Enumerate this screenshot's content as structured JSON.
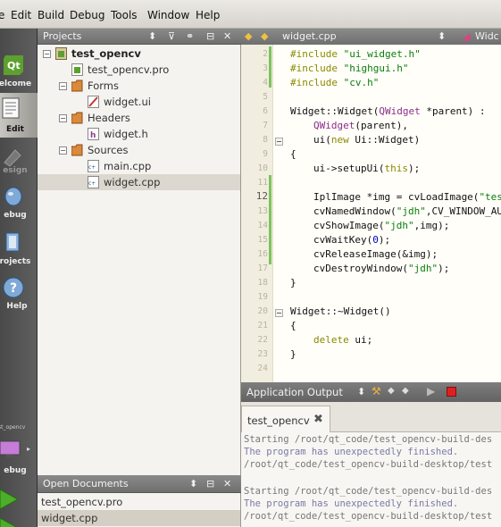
{
  "menu": [
    "e",
    "Edit",
    "Build",
    "Debug",
    "Tools",
    "Window",
    "Help"
  ],
  "modes": {
    "welcome": "elcome",
    "edit": "Edit",
    "design": "esign",
    "debug": "ebug",
    "projects": "rojects",
    "help": "Help",
    "target_small": "test_opencv",
    "target_debug": "ebug"
  },
  "projects_panel": {
    "title": "Projects",
    "project_name": "test_opencv",
    "pro_file": "test_opencv.pro",
    "forms_label": "Forms",
    "form_file": "widget.ui",
    "headers_label": "Headers",
    "header_file": "widget.h",
    "sources_label": "Sources",
    "source_file_1": "main.cpp",
    "source_file_2": "widget.cpp"
  },
  "open_documents": {
    "title": "Open Documents",
    "docs": [
      "test_opencv.pro",
      "widget.cpp"
    ]
  },
  "editor": {
    "file_tab": "widget.cpp",
    "symbol_tab": "Widc",
    "line_numbers": [
      "2",
      "3",
      "4",
      "5",
      "6",
      "7",
      "8",
      "9",
      "10",
      "11",
      "12",
      "13",
      "14",
      "15",
      "16",
      "17",
      "18",
      "19",
      "20",
      "21",
      "22",
      "23",
      "24"
    ],
    "current_line": "12"
  },
  "code_text": {
    "l2_kw": "#include ",
    "l2_str": "\"ui_widget.h\"",
    "l3_kw": "#include ",
    "l3_str": "\"highgui.h\"",
    "l4_kw": "#include ",
    "l4_str": "\"cv.h\"",
    "l6_a": "Widget::Widget(",
    "l6_ty": "QWidget",
    "l6_b": " *parent) :",
    "l7_ty": "QWidget",
    "l7_b": "(parent),",
    "l8_a": "ui(",
    "l8_kw": "new",
    "l8_b": " Ui::Widget)",
    "l9": "{",
    "l10_a": "ui->setupUi(",
    "l10_kw": "this",
    "l10_b": ");",
    "l12_a": "IplImage *img = cvLoadImage(",
    "l12_str": "\"tes",
    "l13_a": "cvNamedWindow(",
    "l13_str": "\"jdh\"",
    "l13_b": ",CV_WINDOW_AU",
    "l14_a": "cvShowImage(",
    "l14_str": "\"jdh\"",
    "l14_b": ",img);",
    "l15_a": "cvWaitKey(",
    "l15_num": "0",
    "l15_b": ");",
    "l16": "cvReleaseImage(&img);",
    "l17_a": "cvDestroyWindow(",
    "l17_str": "\"jdh\"",
    "l17_b": ");",
    "l18": "}",
    "l20": "Widget::~Widget()",
    "l21": "{",
    "l22_kw": "delete",
    "l22_b": " ui;",
    "l23": "}"
  },
  "output": {
    "title": "Application Output",
    "tab": "test_opencv",
    "lines": [
      "Starting /root/qt_code/test_opencv-build-des",
      "The program has unexpectedly finished.",
      "/root/qt_code/test_opencv-build-desktop/test",
      "",
      "Starting /root/qt_code/test_opencv-build-des",
      "The program has unexpectedly finished.",
      "/root/qt_code/test_opencv-build-desktop/test"
    ]
  },
  "colors": {
    "keyword": "#8a8a00",
    "type": "#8b2c8b",
    "string": "#0a7d0a",
    "number": "#0000c0",
    "change_marker": "#7cc45c"
  }
}
